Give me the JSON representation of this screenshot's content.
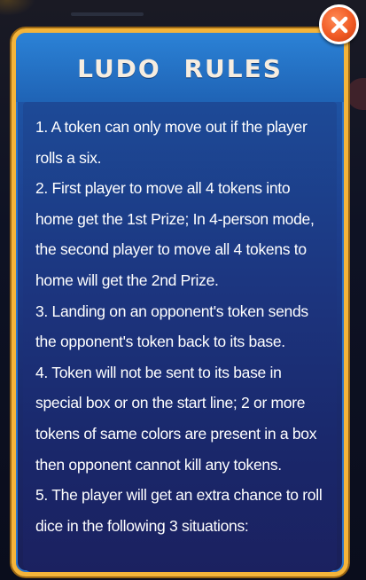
{
  "dialog": {
    "title": "LUDO   RULES",
    "close_icon": "close-icon",
    "rules": [
      "1. A token can only move out if the player rolls a six.",
      "2. First player to move all 4 tokens into home get the 1st Prize; In 4-person mode, the second player to move all 4 tokens to home will get the 2nd Prize.",
      "3. Landing on an opponent's token sends the opponent's token back to its base.",
      "4. Token will not be sent to its base in special box or on the start line; 2 or more tokens of same colors are present in a box then opponent cannot kill any tokens.",
      "5. The player will get an extra chance to roll dice in the following 3 situations:"
    ]
  },
  "colors": {
    "frame": "#f4b43a",
    "panel": "#1d3f8e",
    "close_button": "#f05a24",
    "text": "#ffffff"
  }
}
